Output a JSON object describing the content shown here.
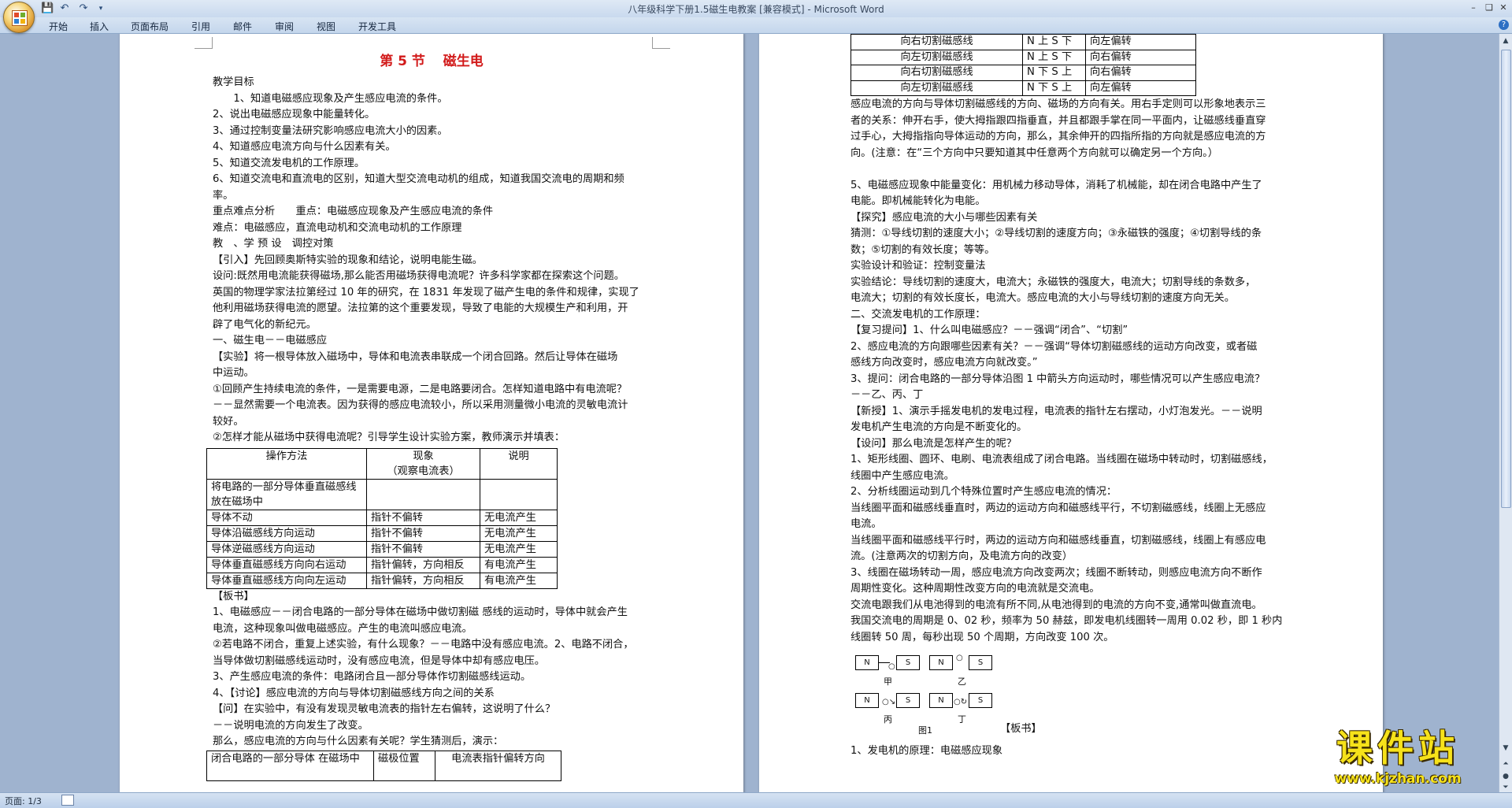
{
  "window": {
    "title": "八年级科学下册1.5磁生电教案 [兼容模式] - Microsoft Word"
  },
  "ribbon_tabs": [
    "开始",
    "插入",
    "页面布局",
    "引用",
    "邮件",
    "审阅",
    "视图",
    "开发工具"
  ],
  "status": {
    "page": "页面: 1/3"
  },
  "watermark": {
    "title": "课件站",
    "url": "www.kjzhan.com"
  },
  "page1": {
    "title": "第 5 节　 磁生电",
    "lines_a": [
      "教学目标",
      "　　1、知道电磁感应现象及产生感应电流的条件。",
      "2、说出电磁感应现象中能量转化。",
      "3、通过控制变量法研究影响感应电流大小的因素。",
      "4、知道感应电流方向与什么因素有关。",
      "5、知道交流发电机的工作原理。",
      "6、知道交流电和直流电的区别，知道大型交流电动机的组成，知道我国交流电的周期和频",
      "率。",
      "重点难点分析　　重点：电磁感应现象及产生感应电流的条件",
      "难点：电磁感应，直流电动机和交流电动机的工作原理",
      "教　、学 预 设　调控对策",
      "【引入】先回顾奥斯特实验的现象和结论，说明电能生磁。",
      "设问:既然用电流能获得磁场,那么能否用磁场获得电流呢？许多科学家都在探索这个问题。",
      "英国的物理学家法拉第经过 10 年的研究，在 1831 年发现了磁产生电的条件和规律，实现了",
      "他利用磁场获得电流的愿望。法拉第的这个重要发现，导致了电能的大规模生产和利用，开",
      "辟了电气化的新纪元。",
      "一、磁生电－－电磁感应",
      "【实验】将一根导体放入磁场中，导体和电流表串联成一个闭合回路。然后让导体在磁场",
      "中运动。",
      "①回顾产生持续电流的条件，一是需要电源，二是电路要闭合。怎样知道电路中有电流呢？",
      "－－显然需要一个电流表。因为获得的感应电流较小，所以采用测量微小电流的灵敏电流计",
      "较好。",
      "②怎样才能从磁场中获得电流呢？引导学生设计实验方案，教师演示并填表："
    ],
    "table1": {
      "headers": [
        "操作方法",
        "现象\n（观察电流表）",
        "说明"
      ],
      "rows": [
        [
          "将电路的一部分导体垂直磁感线放在磁场中",
          "",
          ""
        ],
        [
          "导体不动",
          "指针不偏转",
          "无电流产生"
        ],
        [
          "导体沿磁感线方向运动",
          "指针不偏转",
          "无电流产生"
        ],
        [
          "导体逆磁感线方向运动",
          "指针不偏转",
          "无电流产生"
        ],
        [
          "导体垂直磁感线方向向右运动",
          "指针偏转，方向相反",
          "有电流产生"
        ],
        [
          "导体垂直磁感线方向向左运动",
          "指针偏转，方向相反",
          "有电流产生"
        ]
      ]
    },
    "lines_b": [
      "【板书】",
      "1、电磁感应－－闭合电路的一部分导体在磁场中做切割磁 感线的运动时，导体中就会产生",
      "电流，这种现象叫做电磁感应。产生的电流叫感应电流。",
      "②若电路不闭合，重复上述实验，有什么现象？－－电路中没有感应电流。2、电路不闭合，",
      "当导体做切割磁感线运动时，没有感应电流，但是导体中却有感应电压。",
      "3、产生感应电流的条件：电路闭合且一部分导体作切割磁感线运动。",
      "4、【讨论】感应电流的方向与导体切割磁感线方向之间的关系",
      "【问】在实验中，有没有发现灵敏电流表的指针左右偏转，这说明了什么？",
      "－－说明电流的方向发生了改变。",
      "那么，感应电流的方向与什么因素有关呢？学生猜测后，演示："
    ],
    "table3": {
      "headers": [
        "闭合电路的一部分导体 在磁场中",
        "磁极位置",
        "电流表指针偏转方向"
      ]
    }
  },
  "page2": {
    "table2": {
      "rows": [
        [
          "向右切割磁感线",
          "N 上 S 下",
          "向左偏转"
        ],
        [
          "向左切割磁感线",
          "N 上 S 下",
          "向右偏转"
        ],
        [
          "向右切割磁感线",
          "N 下 S 上",
          "向右偏转"
        ],
        [
          "向左切割磁感线",
          "N 下 S 上",
          "向左偏转"
        ]
      ]
    },
    "lines": [
      "感应电流的方向与导体切割磁感线的方向、磁场的方向有关。用右手定则可以形象地表示三",
      "者的关系：伸开右手，使大拇指跟四指垂直，并且都跟手掌在同一平面内，让磁感线垂直穿",
      "过手心，大拇指指向导体运动的方向，那么，其余伸开的四指所指的方向就是感应电流的方",
      "向。(注意：在“三个方向中只要知道其中任意两个方向就可以确定另一个方向。）",
      "",
      "5、电磁感应现象中能量变化：用机械力移动导体，消耗了机械能，却在闭合电路中产生了",
      "电能。即机械能转化为电能。",
      "【探究】感应电流的大小与哪些因素有关",
      "猜测：①导线切割的速度大小；②导线切割的速度方向；③永磁铁的强度；④切割导线的条",
      "数；⑤切割的有效长度；等等。",
      "实验设计和验证：控制变量法",
      "实验结论：导线切割的速度大，电流大；永磁铁的强度大，电流大；切割导线的条数多，",
      "电流大；切割的有效长度长，电流大。感应电流的大小与导线切割的速度方向无关。",
      "二、交流发电机的工作原理：",
      "【复习提问】1、什么叫电磁感应？－－强调“闭合”、“切割”",
      "2、感应电流的方向跟哪些因素有关？－－强调“导体切割磁感线的运动方向改变，或者磁",
      "感线方向改变时，感应电流方向就改变。”",
      "3、提问：闭合电路的一部分导体沿图 1 中箭头方向运动时，哪些情况可以产生感应电流？",
      "－－乙、丙、丁",
      "【新授】1、演示手摇发电机的发电过程，电流表的指针左右摆动，小灯泡发光。－－说明",
      "发电机产生电流的方向是不断变化的。",
      "【设问】那么电流是怎样产生的呢？",
      "1、矩形线圈、圆环、电刷、电流表组成了闭合电路。当线圈在磁场中转动时，切割磁感线，",
      "线圈中产生感应电流。",
      "2、分析线圈运动到几个特殊位置时产生感应电流的情况：",
      "当线圈平面和磁感线垂直时，两边的运动方向和磁感线平行，不切割磁感线，线圈上无感应",
      "电流。",
      "当线圈平面和磁感线平行时，两边的运动方向和磁感线垂直，切割磁感线，线圈上有感应电",
      "流。(注意两次的切割方向，及电流方向的改变）",
      "3、线圈在磁场转动一周，感应电流方向改变两次；线圈不断转动，则感应电流方向不断作",
      "周期性变化。这种周期性改变方向的电流就是交流电。",
      "交流电跟我们从电池得到的电流有所不同,从电池得到的电流的方向不变,通常叫做直流电。",
      "我国交流电的周期是 0、02 秒，频率为 50 赫兹，即发电机线圈转一周用 0.02 秒，即 1 秒内",
      "线圈转 50 周，每秒出现 50 个周期，方向改变 100 次。"
    ],
    "figure": {
      "labels": [
        "甲",
        "乙",
        "丙",
        "丁",
        "图1"
      ],
      "magnet_n": "N",
      "magnet_s": "S"
    },
    "banshu": "【板书】",
    "last_line": "1、发电机的原理：电磁感应现象"
  }
}
